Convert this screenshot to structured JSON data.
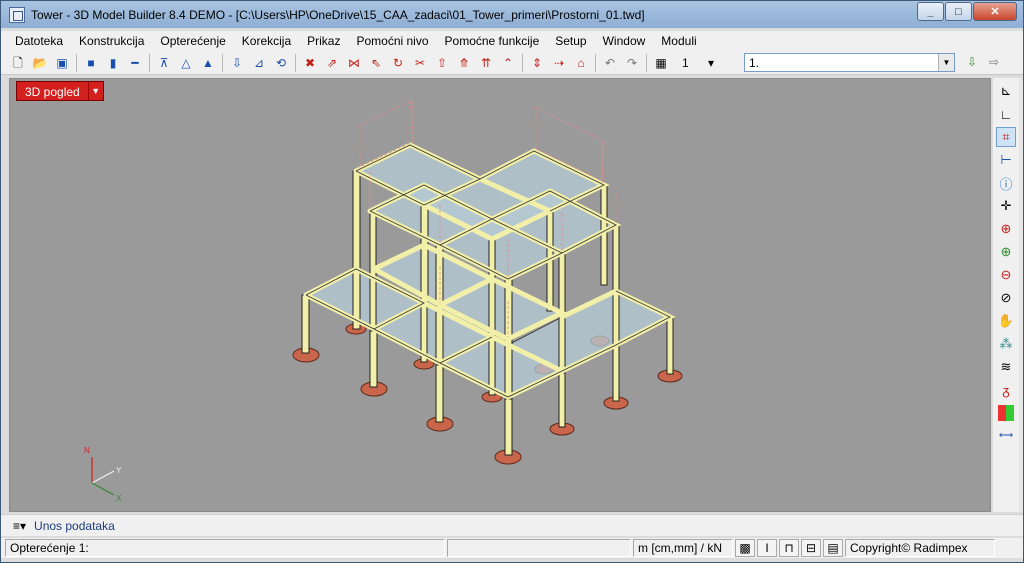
{
  "window": {
    "title": "Tower - 3D Model Builder 8.4 DEMO - [C:\\Users\\HP\\OneDrive\\15_CAA_zadaci\\01_Tower_primeri\\Prostorni_01.twd]",
    "minimize": "_",
    "maximize": "□",
    "close": "✕"
  },
  "menu": [
    "Datoteka",
    "Konstrukcija",
    "Opterećenje",
    "Korekcija",
    "Prikaz",
    "Pomoćni nivo",
    "Pomoćne funkcije",
    "Setup",
    "Window",
    "Moduli"
  ],
  "toolbar": {
    "load_case_number": "1",
    "load_case_arrow": "▾",
    "load_case_name": "1.",
    "dropdown_arrow": "▼"
  },
  "viewport": {
    "view_button": "3D pogled",
    "view_button_arrow": "▼",
    "axis_labels": {
      "z": "N",
      "y": "Y",
      "x": "X"
    }
  },
  "input_bar": {
    "icon": "≡▾",
    "label": "Unos podataka"
  },
  "status": {
    "load_case": "Opterećenje 1:",
    "empty": "",
    "units": "m [cm,mm] / kN",
    "copyright": "Copyright© Radimpex"
  },
  "colors": {
    "title_bar": "#9cbad9",
    "viewport_background": "#9a9a9a",
    "beam": "#f2f0a8",
    "slab": "#b6cbd6",
    "footing": "#c9654a",
    "load": "#e88a8a",
    "view_button": "#d41f1f"
  }
}
